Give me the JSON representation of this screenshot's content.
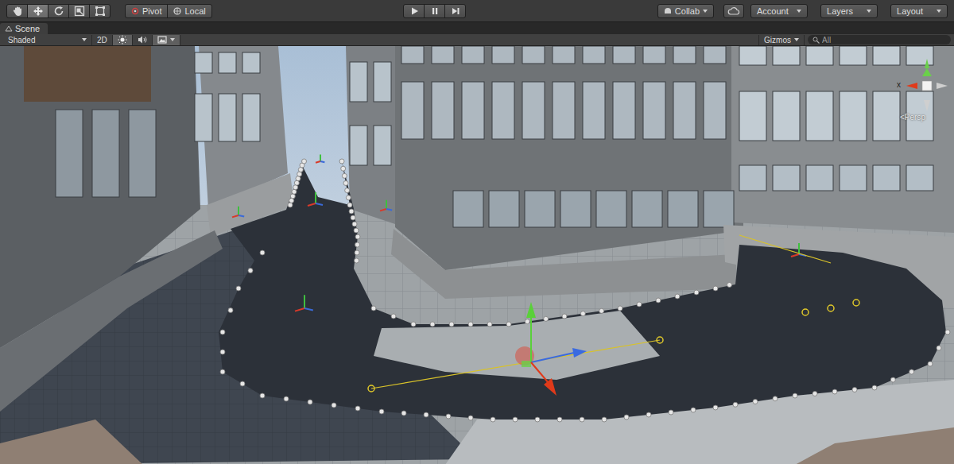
{
  "toolbar": {
    "tools": [
      {
        "kind": "hand",
        "selected": false
      },
      {
        "kind": "move",
        "selected": true
      },
      {
        "kind": "rotate",
        "selected": false
      },
      {
        "kind": "scale",
        "selected": false
      },
      {
        "kind": "rect",
        "selected": false
      }
    ],
    "pivot": {
      "label": "Pivot"
    },
    "space": {
      "label": "Local"
    },
    "playback": [
      {
        "kind": "play",
        "selected": false
      },
      {
        "kind": "pause",
        "selected": false
      },
      {
        "kind": "step",
        "selected": false
      }
    ],
    "collab": {
      "label": "Collab"
    },
    "account": {
      "label": "Account"
    },
    "layers": {
      "label": "Layers"
    },
    "layout": {
      "label": "Layout"
    }
  },
  "scene_tab": {
    "label": "Scene",
    "selected": true
  },
  "scene_toolbar": {
    "draw_mode": "Shaded",
    "mode_2d": {
      "label": "2D",
      "selected": false
    },
    "toggles": [
      {
        "kind": "lighting",
        "selected": true
      },
      {
        "kind": "audio",
        "selected": false
      },
      {
        "kind": "effects",
        "selected": true
      }
    ],
    "gizmos": "Gizmos",
    "search": {
      "placeholder": "All"
    }
  },
  "orientation_gizmo": {
    "axis_label": "x",
    "projection": "<Persp"
  }
}
